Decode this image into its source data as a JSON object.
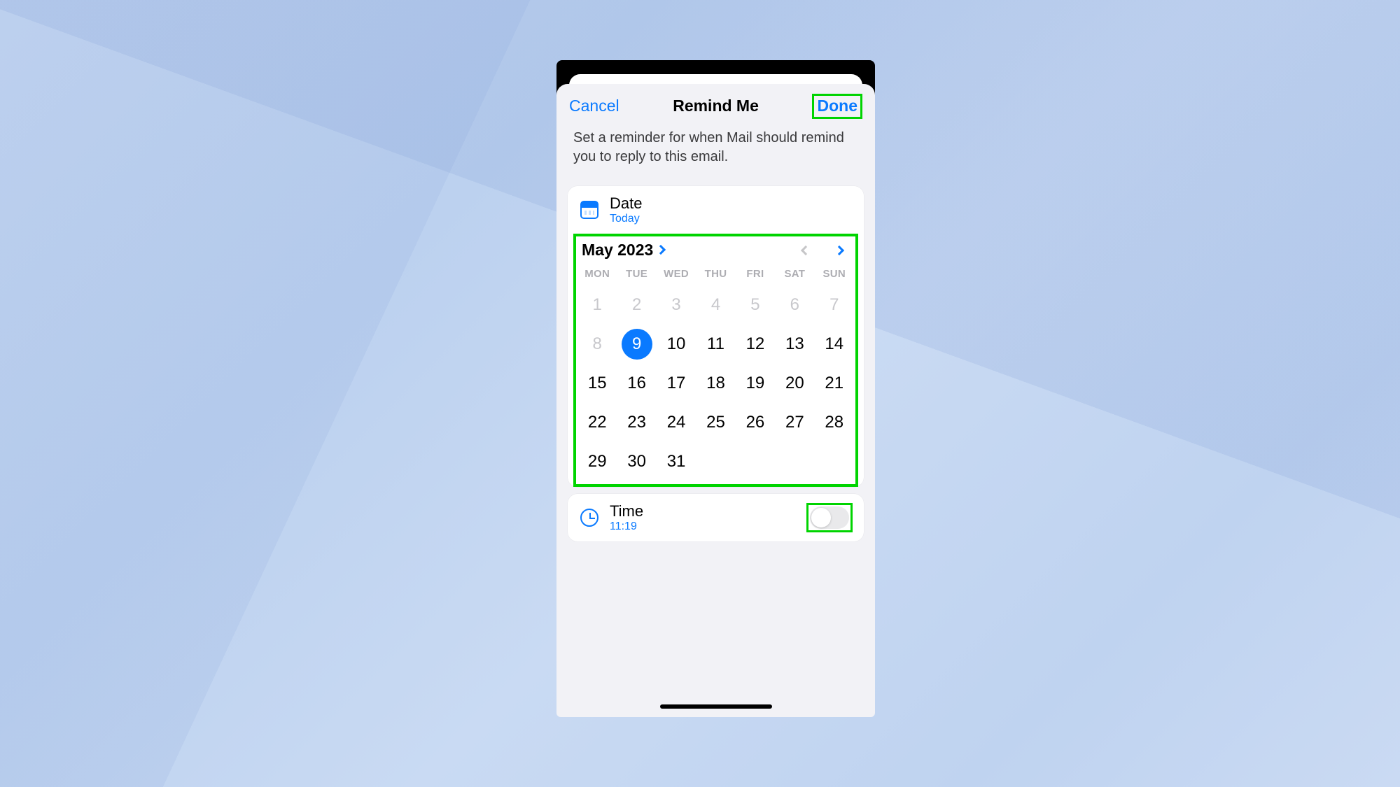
{
  "navbar": {
    "cancel": "Cancel",
    "title": "Remind Me",
    "done": "Done"
  },
  "subhead": "Set a reminder for when Mail should remind you to reply to this email.",
  "date_section": {
    "label": "Date",
    "value": "Today"
  },
  "calendar": {
    "month_label": "May 2023",
    "weekdays": [
      "MON",
      "TUE",
      "WED",
      "THU",
      "FRI",
      "SAT",
      "SUN"
    ],
    "days": [
      {
        "n": "1",
        "dim": true
      },
      {
        "n": "2",
        "dim": true
      },
      {
        "n": "3",
        "dim": true
      },
      {
        "n": "4",
        "dim": true
      },
      {
        "n": "5",
        "dim": true
      },
      {
        "n": "6",
        "dim": true
      },
      {
        "n": "7",
        "dim": true
      },
      {
        "n": "8",
        "dim": true
      },
      {
        "n": "9",
        "sel": true
      },
      {
        "n": "10"
      },
      {
        "n": "11"
      },
      {
        "n": "12"
      },
      {
        "n": "13"
      },
      {
        "n": "14"
      },
      {
        "n": "15"
      },
      {
        "n": "16"
      },
      {
        "n": "17"
      },
      {
        "n": "18"
      },
      {
        "n": "19"
      },
      {
        "n": "20"
      },
      {
        "n": "21"
      },
      {
        "n": "22"
      },
      {
        "n": "23"
      },
      {
        "n": "24"
      },
      {
        "n": "25"
      },
      {
        "n": "26"
      },
      {
        "n": "27"
      },
      {
        "n": "28"
      },
      {
        "n": "29"
      },
      {
        "n": "30"
      },
      {
        "n": "31"
      }
    ],
    "prev_enabled": false,
    "next_enabled": true
  },
  "time_section": {
    "label": "Time",
    "value": "11:19",
    "enabled": false
  }
}
